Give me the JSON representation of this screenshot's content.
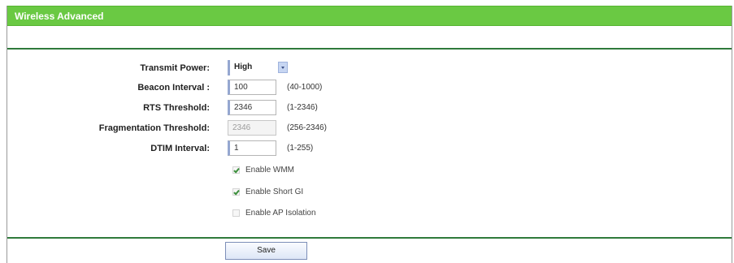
{
  "title": "Wireless Advanced",
  "fields": {
    "transmit_power": {
      "label": "Transmit Power:",
      "value": "High"
    },
    "beacon_interval": {
      "label": "Beacon Interval :",
      "value": "100",
      "unit": "(40-1000)"
    },
    "rts_threshold": {
      "label": "RTS Threshold:",
      "value": "2346",
      "unit": "(1-2346)"
    },
    "fragmentation_threshold": {
      "label": "Fragmentation Threshold:",
      "value": "2346",
      "unit": "(256-2346)"
    },
    "dtim_interval": {
      "label": "DTIM Interval:",
      "value": "1",
      "unit": "(1-255)"
    }
  },
  "checkboxes": [
    {
      "label": "Enable WMM",
      "checked": true
    },
    {
      "label": "Enable Short GI",
      "checked": true
    },
    {
      "label": "Enable AP Isolation",
      "checked": false
    }
  ],
  "save_label": "Save",
  "colors": {
    "title_bar": "#6ac943",
    "divider": "#2f7a3b",
    "field_accent": "#95a7d1"
  }
}
